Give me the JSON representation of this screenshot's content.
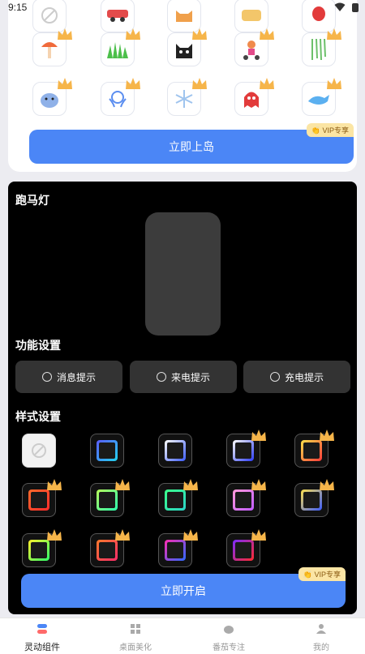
{
  "status": {
    "time": "9:15"
  },
  "island": {
    "rows": [
      [
        "ban-icon",
        "car-icon",
        "cat-icon",
        "toast-icon",
        "balloon-icon"
      ],
      [
        "mushroom-icon",
        "grass-icon",
        "black-cat-icon",
        "scooter-icon",
        "willow-icon"
      ],
      [
        "sloth-icon",
        "jellyfish-icon",
        "snowflake-icon",
        "ghost-icon",
        "whale-icon"
      ]
    ],
    "button_label": "立即上岛",
    "vip_label": "👏 VIP专享"
  },
  "marquee": {
    "title": "跑马灯",
    "function_title": "功能设置",
    "functions": [
      "消息提示",
      "来电提示",
      "充电提示"
    ],
    "style_title": "样式设置",
    "button_label": "立即开启",
    "vip_label": "👏 VIP专享",
    "styles": [
      {
        "icon": "ban-icon"
      },
      {
        "colors": [
          "#5b5bff",
          "#22d3ee"
        ]
      },
      {
        "colors": [
          "#ffffff",
          "#3b5bff"
        ]
      },
      {
        "colors": [
          "#ffffff",
          "#2b3bff"
        ]
      },
      {
        "colors": [
          "#ffe14a",
          "#ff3b3b"
        ]
      },
      {
        "colors": [
          "#ff6a2b",
          "#ff2b2b"
        ]
      },
      {
        "colors": [
          "#b8ff5a",
          "#2bffb0"
        ]
      },
      {
        "colors": [
          "#3bff8a",
          "#2bd3c8"
        ]
      },
      {
        "colors": [
          "#ff9bd8",
          "#c05bff"
        ]
      },
      {
        "colors": [
          "#ffe14a",
          "#3b5bff"
        ]
      },
      {
        "colors": [
          "#ffee2b",
          "#2bff6a"
        ]
      },
      {
        "colors": [
          "#ff7a2b",
          "#ff2b6a"
        ]
      },
      {
        "colors": [
          "#ff2bb0",
          "#2b6aff"
        ]
      },
      {
        "colors": [
          "#7a2bff",
          "#ff2b2b"
        ]
      }
    ]
  },
  "nav": [
    {
      "label": "灵动组件",
      "icon": "toggle-icon",
      "active": true
    },
    {
      "label": "桌面美化",
      "icon": "grid-icon",
      "active": false
    },
    {
      "label": "番茄专注",
      "icon": "tomato-icon",
      "active": false
    },
    {
      "label": "我的",
      "icon": "user-icon",
      "active": false
    }
  ]
}
